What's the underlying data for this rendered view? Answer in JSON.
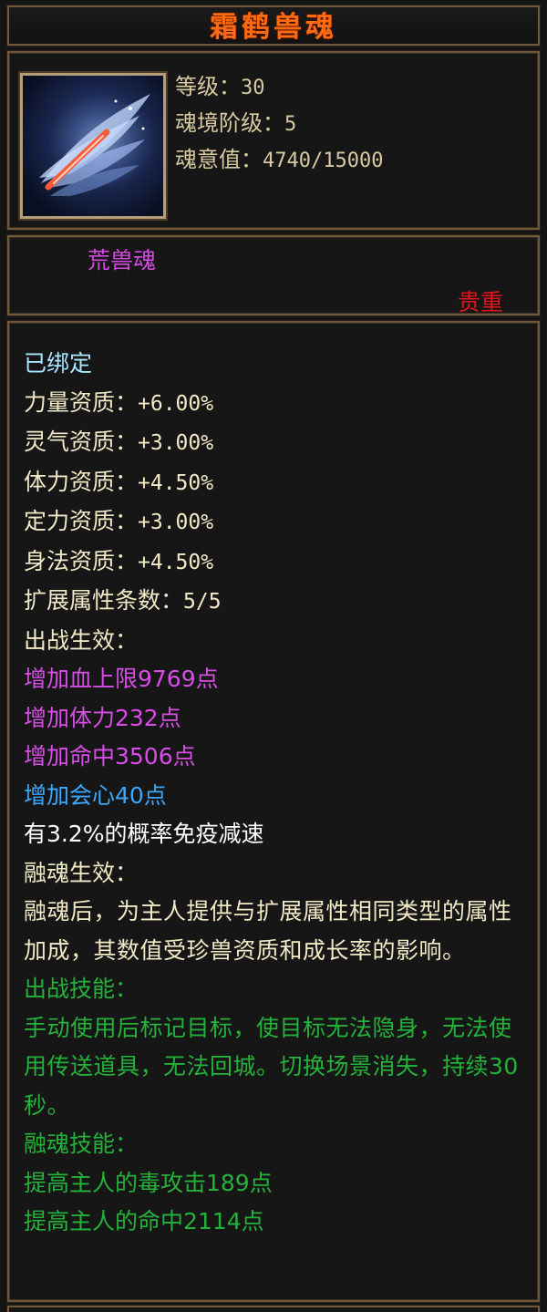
{
  "title": "霜鹤兽魂",
  "header": {
    "icon": "frost-crane-wing-icon",
    "stats": [
      {
        "label": "等级：",
        "value": "30"
      },
      {
        "label": "魂境阶级：",
        "value": "5"
      },
      {
        "label": "魂意值：",
        "value": "4740/15000"
      }
    ]
  },
  "type_row": {
    "kind": "荒兽魂",
    "rarity": "贵重"
  },
  "body": {
    "bound": "已绑定",
    "attributes": [
      {
        "label": "力量资质：",
        "value": "+6.00%"
      },
      {
        "label": "灵气资质：",
        "value": "+3.00%"
      },
      {
        "label": "体力资质：",
        "value": "+4.50%"
      },
      {
        "label": "定力资质：",
        "value": "+3.00%"
      },
      {
        "label": "身法资质：",
        "value": "+4.50%"
      },
      {
        "label": "扩展属性条数：",
        "value": "5/5"
      }
    ],
    "battle_effect_header": "出战生效：",
    "battle_effects": [
      {
        "text": "增加血上限9769点",
        "color": "#d84de6"
      },
      {
        "text": "增加体力232点",
        "color": "#d84de6"
      },
      {
        "text": "增加命中3506点",
        "color": "#d84de6"
      },
      {
        "text": "增加会心40点",
        "color": "#3aa8ff"
      },
      {
        "text": "有3.2%的概率免疫减速",
        "color": "#ffffff"
      }
    ],
    "fusion_effect_header": "融魂生效：",
    "fusion_effect_desc": "融魂后，为主人提供与扩展属性相同类型的属性加成，其数值受珍兽资质和成长率的影响。",
    "battle_skill_header": "出战技能：",
    "battle_skill_desc": "手动使用后标记目标，使目标无法隐身，无法使用传送道具，无法回城。切换场景消失，持续30秒。",
    "fusion_skill_header": "融魂技能：",
    "fusion_skills": [
      "提高主人的毒攻击189点",
      "提高主人的命中2114点"
    ]
  },
  "colors": {
    "title": "#ff6a12",
    "magic_attr": "#d84de6",
    "crit_attr": "#3aa8ff",
    "skill": "#24b23a",
    "rarity": "#e4141a",
    "bound": "#a9e6ff"
  }
}
